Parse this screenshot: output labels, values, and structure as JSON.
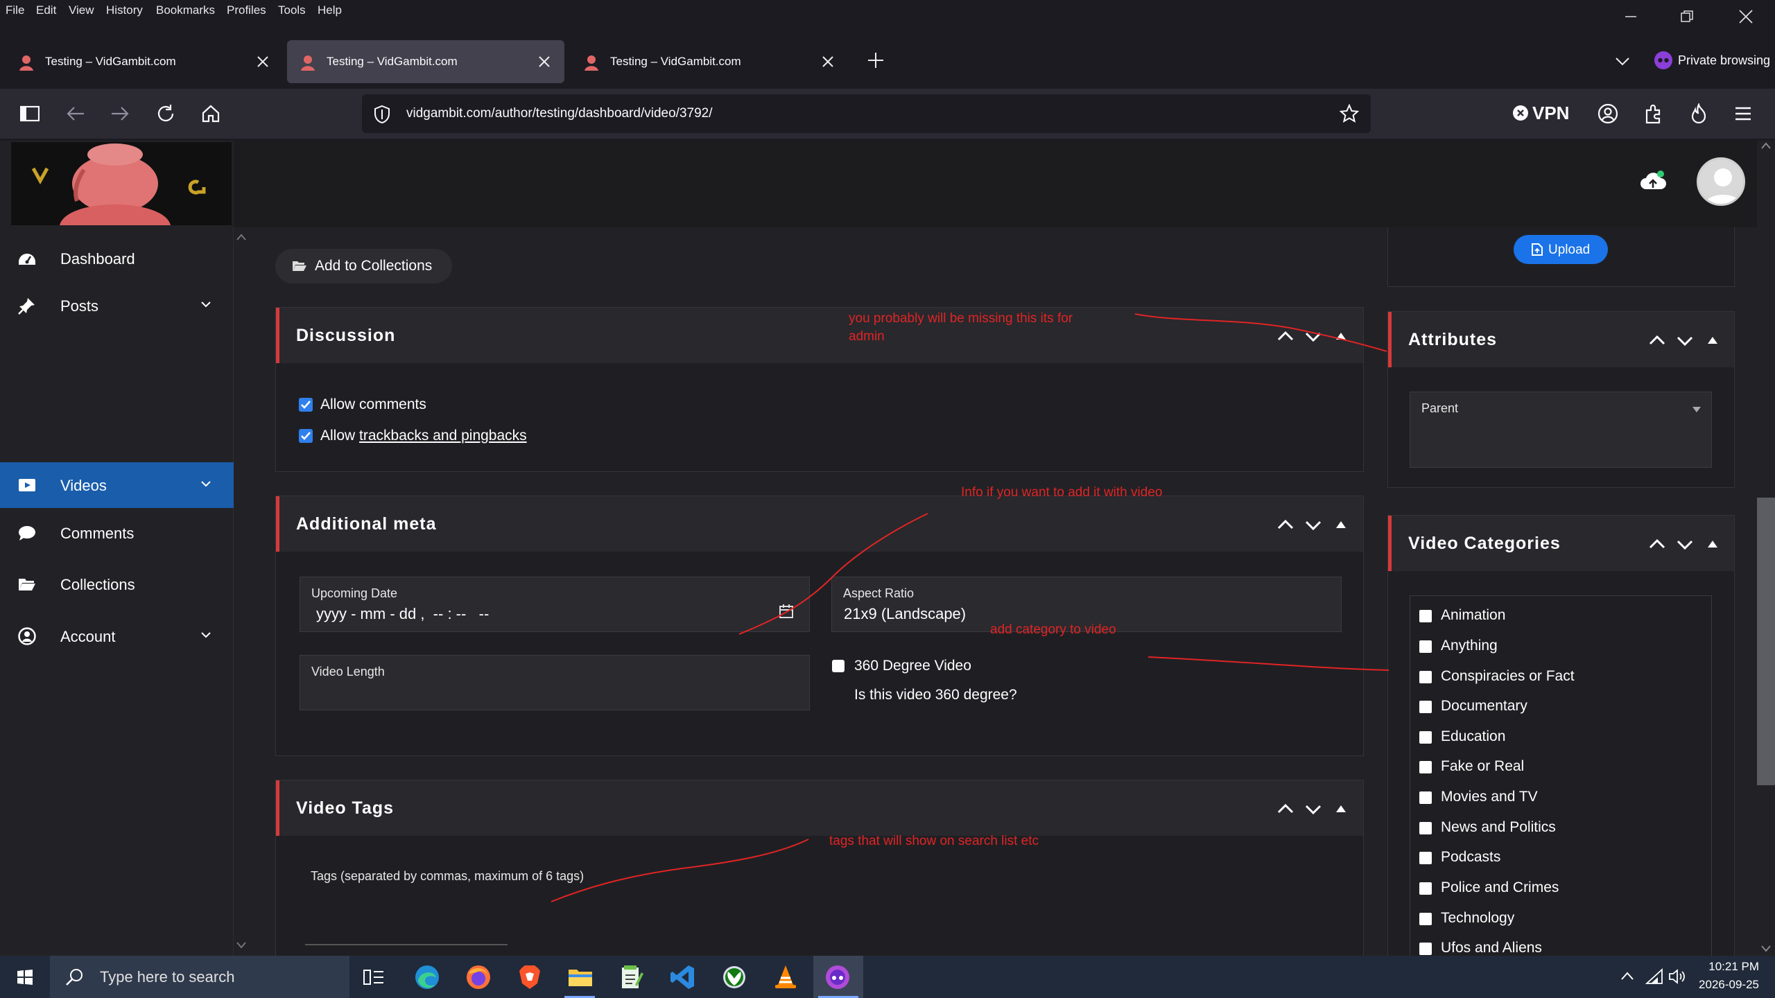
{
  "menubar": {
    "items": [
      "File",
      "Edit",
      "View",
      "History",
      "Bookmarks",
      "Profiles",
      "Tools",
      "Help"
    ]
  },
  "tabs": [
    {
      "title": "Testing – VidGambit.com",
      "active": false
    },
    {
      "title": "Testing – VidGambit.com",
      "active": true
    },
    {
      "title": "Testing – VidGambit.com",
      "active": false
    }
  ],
  "browser": {
    "private_label": "Private browsing",
    "url": "vidgambit.com/author/testing/dashboard/video/3792/",
    "vpn_label": "VPN"
  },
  "sidebar": {
    "items": [
      {
        "label": "Dashboard",
        "icon": "dashboard-icon",
        "has_chevron": false
      },
      {
        "label": "Posts",
        "icon": "pin-icon",
        "has_chevron": true
      },
      {
        "label": "Videos",
        "icon": "video-icon",
        "has_chevron": true,
        "active": true
      },
      {
        "label": "Comments",
        "icon": "comment-icon",
        "has_chevron": false
      },
      {
        "label": "Collections",
        "icon": "folder-icon",
        "has_chevron": false
      },
      {
        "label": "Account",
        "icon": "user-circle-icon",
        "has_chevron": true
      }
    ]
  },
  "main": {
    "add_to_collections": "Add to Collections",
    "upload_label": "Upload",
    "discussion": {
      "title": "Discussion",
      "allow_comments": "Allow comments",
      "allow_prefix": "Allow ",
      "trackbacks_link": "trackbacks and pingbacks"
    },
    "additional_meta": {
      "title": "Additional meta",
      "upcoming_date_label": "Upcoming Date",
      "upcoming_date_value": "yyyy - mm - dd ,  -- : --   --",
      "aspect_ratio_label": "Aspect Ratio",
      "aspect_ratio_value": "21x9 (Landscape)",
      "video_length_label": "Video Length",
      "degree_360_label": "360 Degree Video",
      "degree_360_help": "Is this video 360 degree?"
    },
    "video_tags": {
      "title": "Video Tags",
      "tags_label": "Tags (separated by commas, maximum of 6 tags)"
    }
  },
  "right": {
    "attributes": {
      "title": "Attributes",
      "parent_label": "Parent"
    },
    "video_categories": {
      "title": "Video Categories",
      "items": [
        "Animation",
        "Anything",
        "Conspiracies or Fact",
        "Documentary",
        "Education",
        "Fake or Real",
        "Movies and TV",
        "News and Politics",
        "Podcasts",
        "Police and Crimes",
        "Technology",
        "Ufos and Aliens"
      ]
    }
  },
  "annotations": {
    "admin_note_1": "you probably will be missing this its for",
    "admin_note_2": "admin",
    "info_note": "Info if you want to add it with video",
    "category_note": "add category to video",
    "tags_note": "tags that will show on search list etc"
  },
  "taskbar": {
    "search_placeholder": "Type here to search",
    "time": "10:21 PM",
    "date": "2026-09-25"
  },
  "colors": {
    "accent_blue": "#1a5dab",
    "upload_blue": "#1a73e8",
    "panel_red": "#d63a3a",
    "annotation_red": "#e12424"
  }
}
